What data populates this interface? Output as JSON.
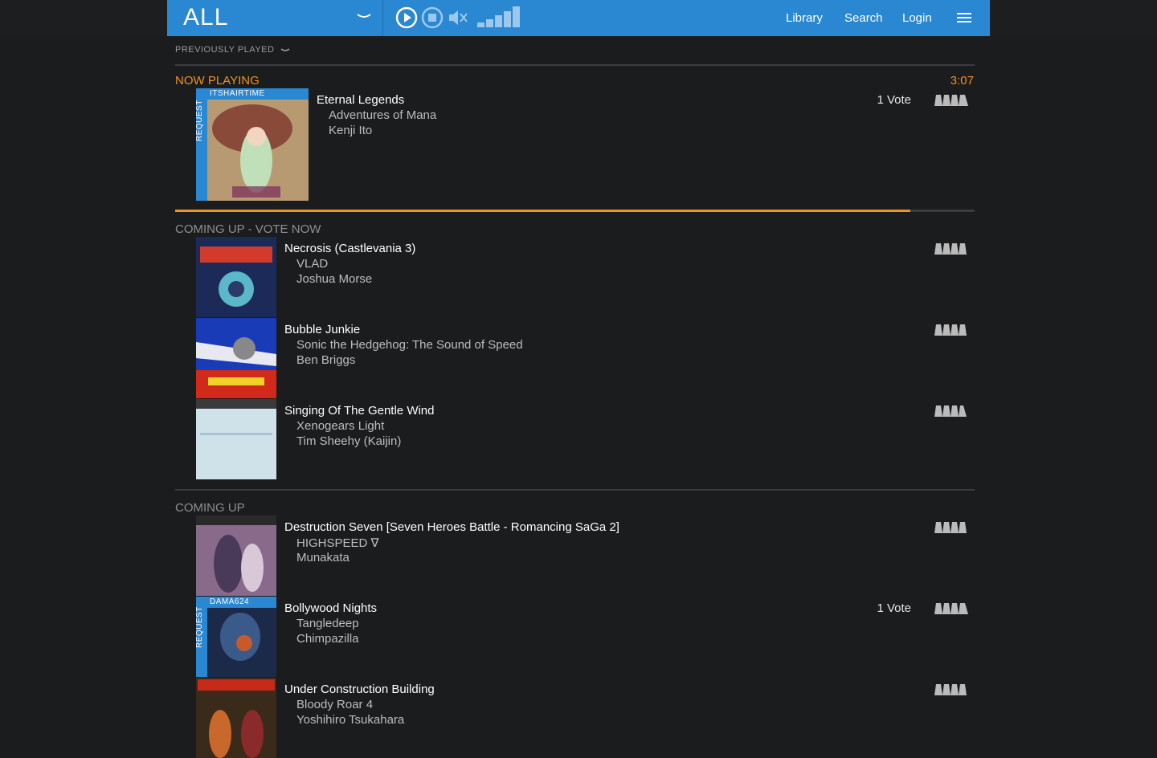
{
  "header": {
    "station": "ALL",
    "nav": {
      "library": "Library",
      "search": "Search",
      "login": "Login"
    },
    "accent_color": "#2a87d2"
  },
  "previously_played": "PREVIOUSLY PLAYED",
  "now_playing": {
    "heading": "NOW PLAYING",
    "time_remaining": "3:07",
    "progress_fraction": 0.92,
    "song": {
      "title": "Eternal Legends",
      "album": "Adventures of Mana",
      "artist": "Kenji Ito",
      "votes": "1 Vote",
      "request_label": "REQUEST",
      "requester": "ITSHAIRTIME"
    }
  },
  "coming_up_vote": {
    "heading": "COMING UP - VOTE NOW",
    "songs": [
      {
        "title": "Necrosis (Castlevania 3)",
        "album": "VLAD",
        "artist": "Joshua Morse"
      },
      {
        "title": "Bubble Junkie",
        "album": "Sonic the Hedgehog: The Sound of Speed",
        "artist": "Ben Briggs"
      },
      {
        "title": "Singing Of The Gentle Wind",
        "album": "Xenogears Light",
        "artist": "Tim Sheehy (Kaijin)"
      }
    ]
  },
  "coming_up": {
    "heading": "COMING UP",
    "songs": [
      {
        "title": "Destruction Seven [Seven Heroes Battle - Romancing SaGa 2]",
        "album": "HIGHSPEED ∇",
        "artist": "Munakata"
      },
      {
        "title": "Bollywood Nights",
        "album": "Tangledeep",
        "artist": "Chimpazilla",
        "votes": "1 Vote",
        "request_label": "REQUEST",
        "requester": "DAMA624"
      },
      {
        "title": "Under Construction Building",
        "album": "Bloody Roar 4",
        "artist": "Yoshihiro Tsukahara"
      }
    ]
  }
}
